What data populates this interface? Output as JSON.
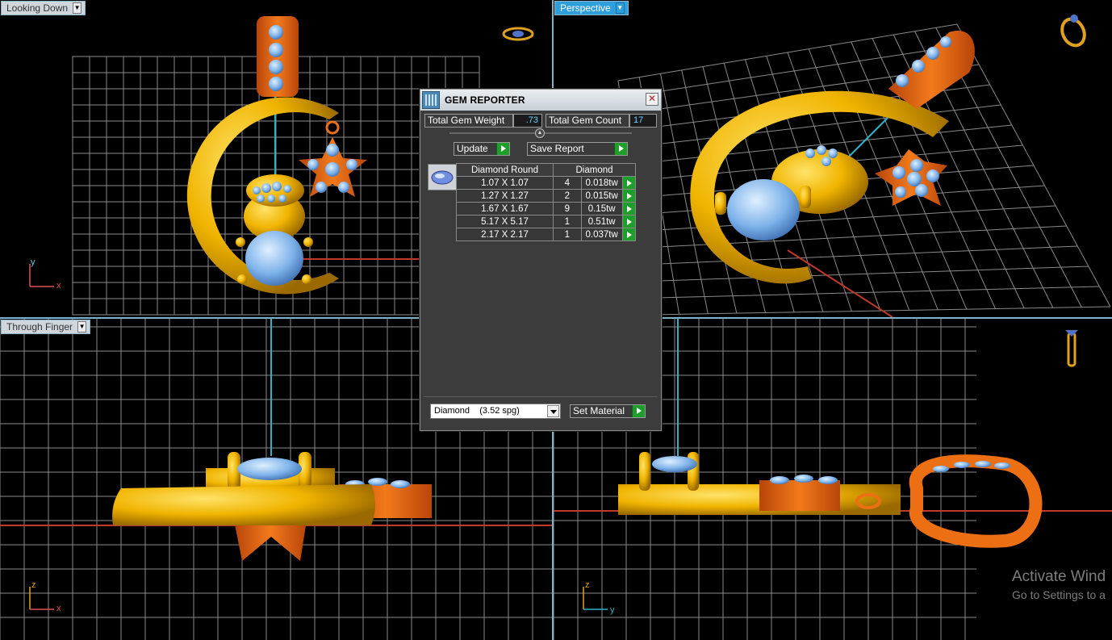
{
  "viewports": {
    "top_left": {
      "label": "Looking Down"
    },
    "top_right": {
      "label": "Perspective"
    },
    "bottom_left": {
      "label": "Through Finger"
    }
  },
  "axes": {
    "top_left": {
      "vertical": "y",
      "horizontal": "x"
    },
    "bottom_left": {
      "vertical": "z",
      "horizontal": "x"
    },
    "bottom_right": {
      "vertical": "z",
      "horizontal": "y"
    }
  },
  "gem_reporter": {
    "title": "GEM REPORTER",
    "close_glyph": "✕",
    "total_weight_label": "Total Gem Weight",
    "total_weight_value": ".73",
    "total_count_label": "Total Gem Count",
    "total_count_value": "17",
    "update_label": "Update",
    "save_report_label": "Save Report",
    "table": {
      "headers": [
        "Diamond Round",
        "Diamond"
      ],
      "rows": [
        {
          "size": "1.07 X 1.07",
          "count": "4",
          "weight": "0.018tw"
        },
        {
          "size": "1.27 X 1.27",
          "count": "2",
          "weight": "0.015tw"
        },
        {
          "size": "1.67 X 1.67",
          "count": "9",
          "weight": "0.15tw"
        },
        {
          "size": "5.17 X 5.17",
          "count": "1",
          "weight": "0.51tw"
        },
        {
          "size": "2.17 X 2.17",
          "count": "1",
          "weight": "0.037tw"
        }
      ]
    },
    "material_select": "Diamond    (3.52 spg)",
    "set_material_label": "Set Material"
  },
  "watermark": {
    "line1": "Activate Wind",
    "line2": "Go to Settings to a"
  },
  "colors": {
    "gold": "#f0b400",
    "gold_dark": "#b97f00",
    "copper": "#ec6f14",
    "gem_blue": "#7fb3ea",
    "grid": "#8a8a8a",
    "divider": "#7fb4c8",
    "axis_x": "#c0392b",
    "axis_cyan": "#2bb3c8",
    "button_green": "#1e9e2a"
  },
  "icons": [
    "ring-top-icon",
    "ring-perspective-icon",
    "ring-side-icon",
    "dropdown-icon",
    "close-icon",
    "play-arrow-icon"
  ]
}
